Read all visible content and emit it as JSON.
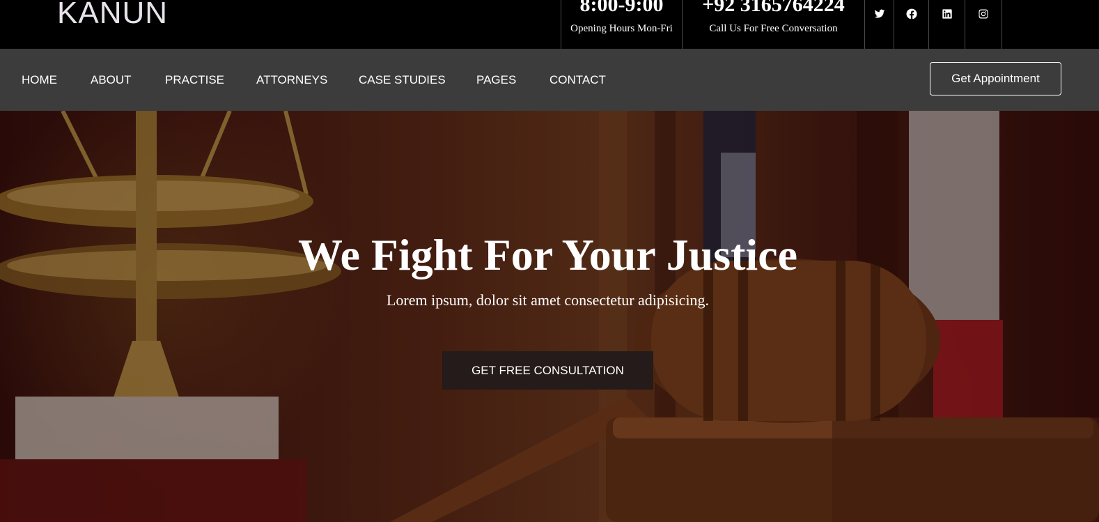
{
  "brand": {
    "logo_text": "KANUN"
  },
  "topbar": {
    "hours": {
      "value": "8:00-9:00",
      "label": "Opening Hours Mon-Fri"
    },
    "phone": {
      "value": "+92 3165764224",
      "label": "Call Us For Free Conversation"
    },
    "social": [
      {
        "icon": "twitter-icon"
      },
      {
        "icon": "facebook-icon"
      },
      {
        "icon": "linkedin-icon"
      },
      {
        "icon": "instagram-icon"
      }
    ]
  },
  "nav": {
    "items": [
      {
        "label": "HOME"
      },
      {
        "label": "ABOUT"
      },
      {
        "label": "PRACTISE"
      },
      {
        "label": "ATTORNEYS"
      },
      {
        "label": "CASE STUDIES"
      },
      {
        "label": "PAGES"
      },
      {
        "label": "CONTACT"
      }
    ],
    "appointment_label": "Get Appointment"
  },
  "hero": {
    "title": "We Fight For Your Justice",
    "subtitle": "Lorem ipsum, dolor sit amet consectetur adipisicing.",
    "cta_label": "GET FREE CONSULTATION"
  },
  "colors": {
    "topbar_bg": "#000000",
    "navbar_bg": "#3c3c3c",
    "cta_bg": "#241b1a",
    "text": "#ffffff"
  }
}
